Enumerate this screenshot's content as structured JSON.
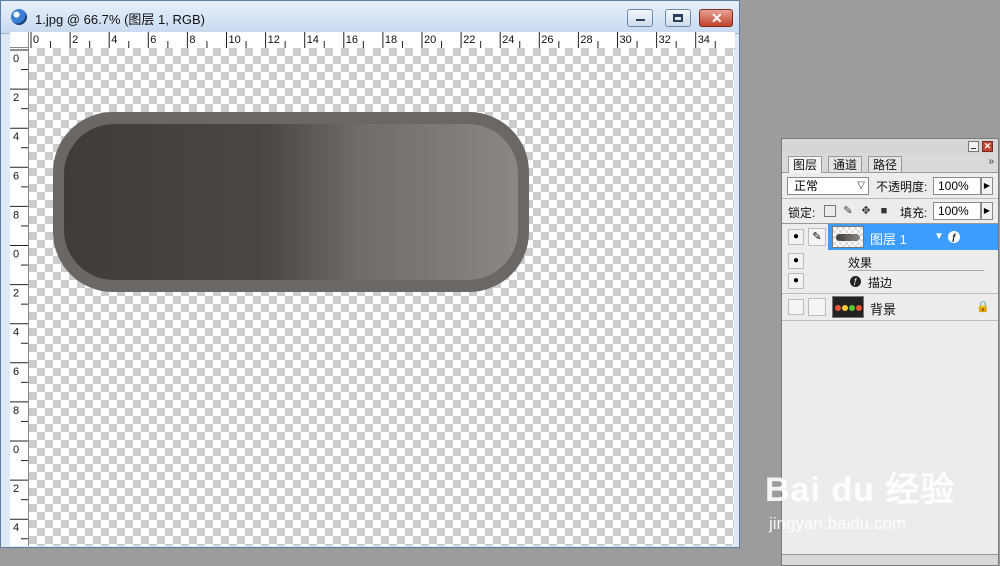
{
  "window": {
    "title": "1.jpg @ 66.7% (图层 1, RGB)",
    "close_glyph": "✕"
  },
  "ruler": {
    "h_labels": [
      "0",
      "2",
      "4",
      "6",
      "8",
      "10",
      "12",
      "14",
      "16",
      "18",
      "20",
      "22",
      "24",
      "26",
      "28",
      "30",
      "32",
      "34"
    ],
    "v_labels": [
      "0",
      "2",
      "4",
      "6",
      "8",
      "0",
      "2",
      "4",
      "6",
      "8",
      "0",
      "2",
      "4"
    ]
  },
  "panel": {
    "tabs": [
      "图层",
      "通道",
      "路径"
    ],
    "blend_mode": "正常",
    "opacity_label": "不透明度:",
    "opacity_value": "100%",
    "lock_label": "锁定:",
    "fill_label": "填充:",
    "fill_value": "100%",
    "layers": [
      {
        "name": "图层 1",
        "selected": true
      },
      {
        "name": "背景",
        "selected": false
      }
    ],
    "effects_label": "效果",
    "stroke_label": "描边"
  },
  "watermark": {
    "brand": "Bai du 经验",
    "url": "jingyan.baidu.com"
  },
  "colors": {
    "selection": "#3c9cff",
    "close_red": "#c4432d"
  }
}
